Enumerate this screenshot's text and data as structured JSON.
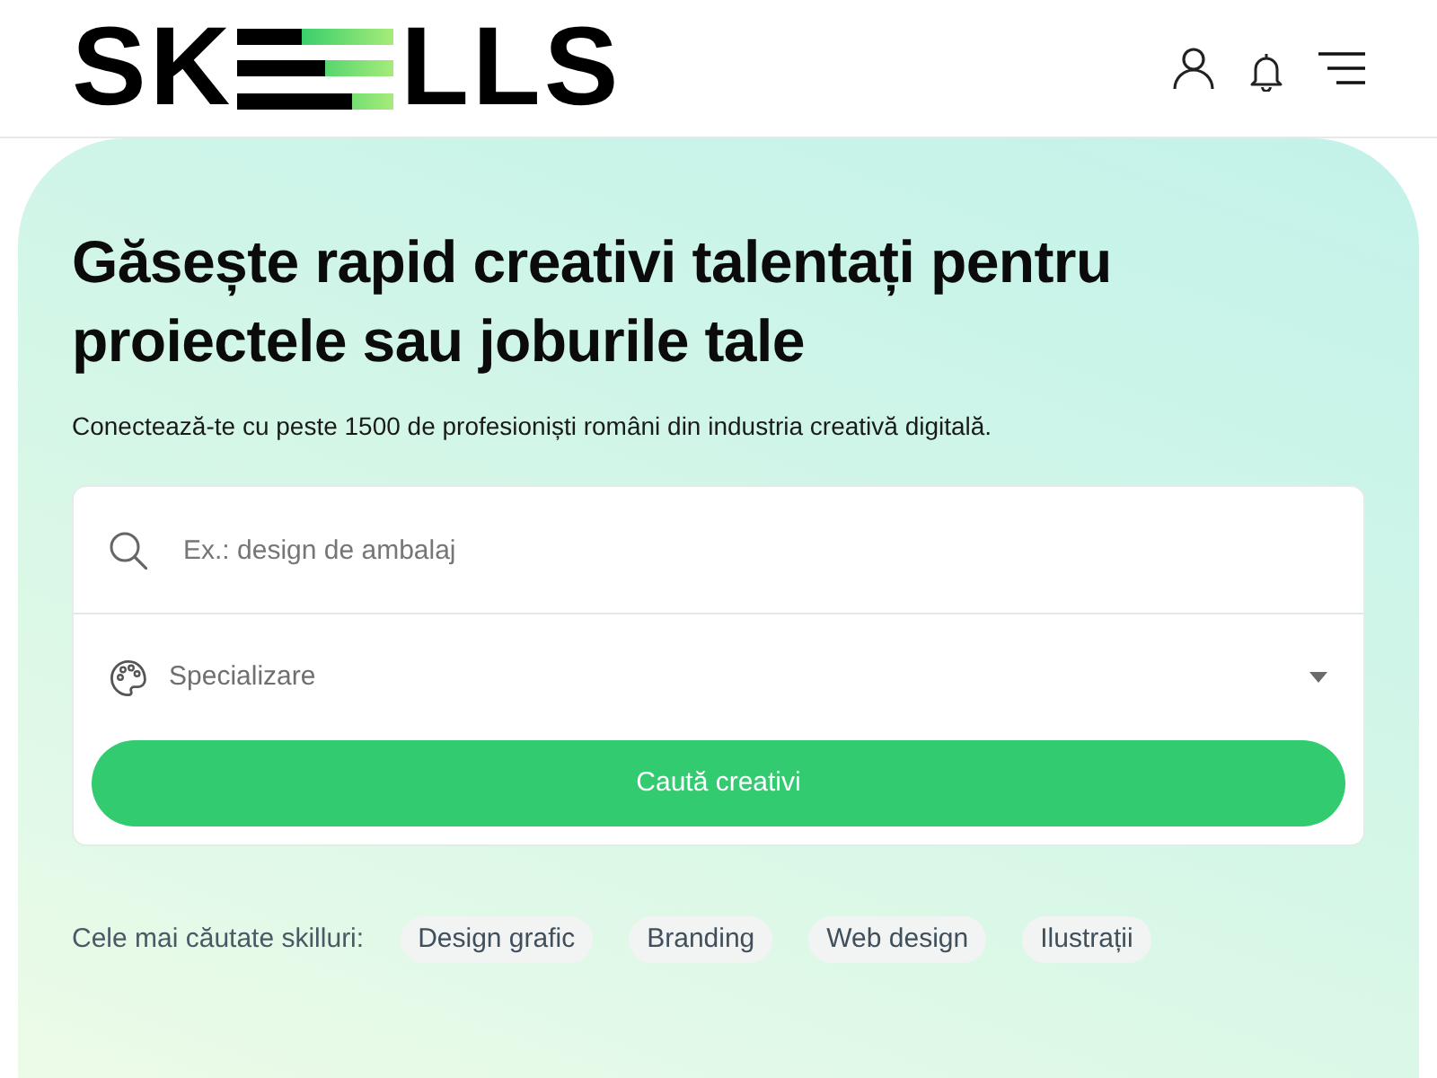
{
  "header": {
    "logo": {
      "left": "SK",
      "right": "LLS"
    }
  },
  "hero": {
    "title": "Găsește rapid creativi talentați pentru proiectele sau joburile tale",
    "subtitle": "Conectează-te cu peste 1500 de profesioniști români din industria creativă digitală.",
    "search": {
      "placeholder": "Ex.: design de ambalaj"
    },
    "specialization": {
      "placeholder": "Specializare"
    },
    "button": "Caută creativi",
    "popular": {
      "label": "Cele mai căutate skilluri:",
      "tags": [
        "Design grafic",
        "Branding",
        "Web design",
        "Ilustrații"
      ]
    }
  }
}
